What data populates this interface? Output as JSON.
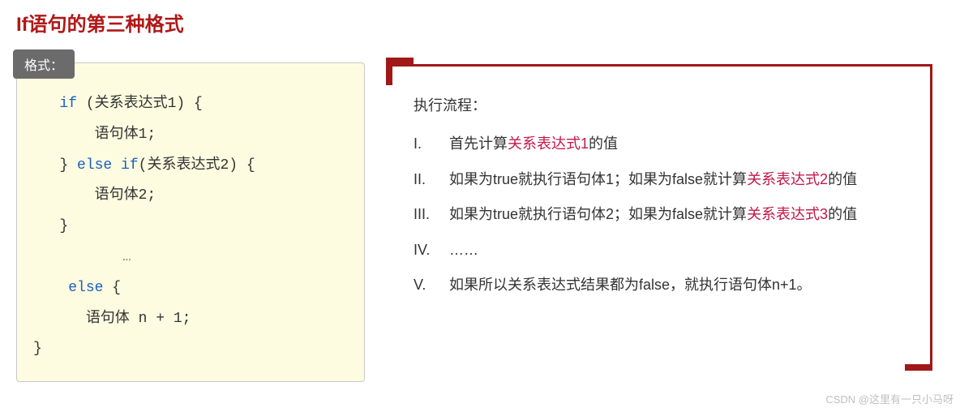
{
  "title": "If语句的第三种格式",
  "code_panel": {
    "tag": "格式：",
    "tokens": {
      "if": "if",
      "open1": " (关系表达式1) {",
      "body1": "语句体1;",
      "close_else_if": "} ",
      "else": "else",
      "if2": " if",
      "open2": "(关系表达式2) {",
      "body2": "语句体2;",
      "close2": "}",
      "ellipsis": "…",
      "else2": "else",
      "open3": " {",
      "bodyN": "语句体 n + 1;",
      "close3": "}"
    }
  },
  "flow_panel": {
    "heading": "执行流程：",
    "items": [
      {
        "roman": "I.",
        "segments": [
          {
            "t": "首先计算"
          },
          {
            "t": "关系表达式1",
            "hl": true
          },
          {
            "t": "的值"
          }
        ]
      },
      {
        "roman": "II.",
        "segments": [
          {
            "t": "如果为true就执行语句体1；如果为false就计算"
          },
          {
            "t": "关系表达式2",
            "hl": true
          },
          {
            "t": "的值"
          }
        ]
      },
      {
        "roman": "III.",
        "segments": [
          {
            "t": "如果为true就执行语句体2；如果为false就计算"
          },
          {
            "t": "关系表达式3",
            "hl": true
          },
          {
            "t": "的值"
          }
        ]
      },
      {
        "roman": "IV.",
        "segments": [
          {
            "t": "……"
          }
        ]
      },
      {
        "roman": "V.",
        "segments": [
          {
            "t": "如果所以关系表达式结果都为false，就执行语句体n+1。"
          }
        ]
      }
    ]
  },
  "watermark": "CSDN @这里有一只小马呀"
}
